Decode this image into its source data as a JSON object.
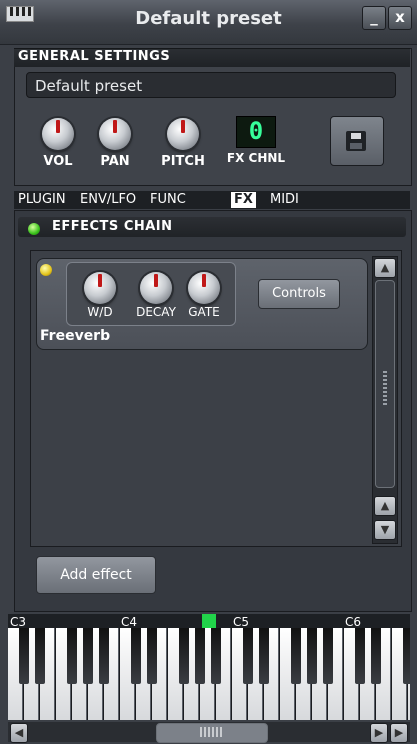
{
  "window": {
    "title": "Default preset",
    "minimize": "_",
    "close": "x"
  },
  "general": {
    "heading": "GENERAL SETTINGS",
    "preset_name": "Default preset",
    "knobs": [
      "VOL",
      "PAN",
      "PITCH"
    ],
    "fx_channel_label": "FX CHNL",
    "fx_channel_value": "0"
  },
  "tabs": [
    "PLUGIN",
    "ENV/LFO",
    "FUNC",
    "FX",
    "MIDI"
  ],
  "active_tab": "FX",
  "effects_chain": {
    "heading": "EFFECTS CHAIN",
    "effect": {
      "name": "Freeverb",
      "knobs": [
        "W/D",
        "DECAY",
        "GATE"
      ],
      "controls_label": "Controls"
    },
    "add_effect_label": "Add effect"
  },
  "keyboard": {
    "octaves": [
      "C3",
      "C4",
      "C5",
      "C6"
    ]
  },
  "colors": {
    "led_active": "#39c21b",
    "led_effect": "#e4c41b",
    "lcd_digit": "#36ff9a",
    "key_marker": "#21d44a"
  }
}
